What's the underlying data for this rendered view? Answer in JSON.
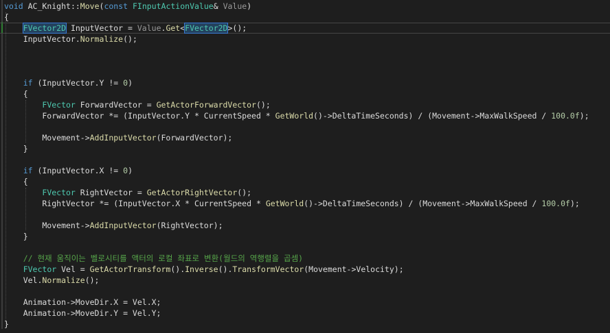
{
  "editor": {
    "colors": {
      "background": "#1e1e1e",
      "keyword": "#569cd6",
      "type": "#4ec9b0",
      "function": "#dcdcaa",
      "parameter": "#9a9a9a",
      "number": "#b5cea8",
      "comment": "#57a64a",
      "text": "#dcdcdc"
    },
    "lines": [
      [
        {
          "t": "void",
          "c": "kw"
        },
        {
          "t": " AC_Knight::"
        },
        {
          "t": "Move",
          "c": "fn"
        },
        {
          "t": "("
        },
        {
          "t": "const",
          "c": "kw"
        },
        {
          "t": " "
        },
        {
          "t": "FInputActionValue",
          "c": "ty"
        },
        {
          "t": "& "
        },
        {
          "t": "Value",
          "c": "pa"
        },
        {
          "t": ")"
        }
      ],
      [
        {
          "t": "{"
        }
      ],
      [
        {
          "t": "    "
        },
        {
          "t": "FVector2D",
          "c": "ty hl"
        },
        {
          "t": " InputVector = "
        },
        {
          "t": "Value",
          "c": "pa"
        },
        {
          "t": "."
        },
        {
          "t": "Get",
          "c": "fn"
        },
        {
          "t": "<"
        },
        {
          "t": "FVector2D",
          "c": "ty hl"
        },
        {
          "t": ">();"
        }
      ],
      [
        {
          "t": "    InputVector."
        },
        {
          "t": "Normalize",
          "c": "fn"
        },
        {
          "t": "();"
        }
      ],
      [],
      [],
      [],
      [
        {
          "t": "    "
        },
        {
          "t": "if",
          "c": "kw"
        },
        {
          "t": " (InputVector.Y != "
        },
        {
          "t": "0",
          "c": "nu"
        },
        {
          "t": ")"
        }
      ],
      [
        {
          "t": "    {"
        }
      ],
      [
        {
          "t": "        "
        },
        {
          "t": "FVector",
          "c": "ty"
        },
        {
          "t": " ForwardVector = "
        },
        {
          "t": "GetActorForwardVector",
          "c": "fn"
        },
        {
          "t": "();"
        }
      ],
      [
        {
          "t": "        ForwardVector *= (InputVector.Y * CurrentSpeed * "
        },
        {
          "t": "GetWorld",
          "c": "fn"
        },
        {
          "t": "()->DeltaTimeSeconds) / (Movement->MaxWalkSpeed / "
        },
        {
          "t": "100.0f",
          "c": "nu"
        },
        {
          "t": ");"
        }
      ],
      [],
      [
        {
          "t": "        Movement->"
        },
        {
          "t": "AddInputVector",
          "c": "fn"
        },
        {
          "t": "(ForwardVector);"
        }
      ],
      [
        {
          "t": "    }"
        }
      ],
      [],
      [
        {
          "t": "    "
        },
        {
          "t": "if",
          "c": "kw"
        },
        {
          "t": " (InputVector.X != "
        },
        {
          "t": "0",
          "c": "nu"
        },
        {
          "t": ")"
        }
      ],
      [
        {
          "t": "    {"
        }
      ],
      [
        {
          "t": "        "
        },
        {
          "t": "FVector",
          "c": "ty"
        },
        {
          "t": " RightVector = "
        },
        {
          "t": "GetActorRightVector",
          "c": "fn"
        },
        {
          "t": "();"
        }
      ],
      [
        {
          "t": "        RightVector *= (InputVector.X * CurrentSpeed * "
        },
        {
          "t": "GetWorld",
          "c": "fn"
        },
        {
          "t": "()->DeltaTimeSeconds) / (Movement->MaxWalkSpeed / "
        },
        {
          "t": "100.0f",
          "c": "nu"
        },
        {
          "t": ");"
        }
      ],
      [],
      [
        {
          "t": "        Movement->"
        },
        {
          "t": "AddInputVector",
          "c": "fn"
        },
        {
          "t": "(RightVector);"
        }
      ],
      [
        {
          "t": "    }"
        }
      ],
      [],
      [
        {
          "t": "    // 현재 움직이는 벨로시티를 액터의 로컬 좌표로 변환(월드의 역행렬을 곱셈)",
          "c": "cm"
        }
      ],
      [
        {
          "t": "    "
        },
        {
          "t": "FVector",
          "c": "ty"
        },
        {
          "t": " Vel = "
        },
        {
          "t": "GetActorTransform",
          "c": "fn"
        },
        {
          "t": "()."
        },
        {
          "t": "Inverse",
          "c": "fn"
        },
        {
          "t": "()."
        },
        {
          "t": "TransformVector",
          "c": "fn"
        },
        {
          "t": "(Movement->Velocity);"
        }
      ],
      [
        {
          "t": "    Vel."
        },
        {
          "t": "Normalize",
          "c": "fn"
        },
        {
          "t": "();"
        }
      ],
      [],
      [
        {
          "t": "    Animation->MoveDir.X = Vel.X;"
        }
      ],
      [
        {
          "t": "    Animation->MoveDir.Y = Vel.Y;"
        }
      ],
      [
        {
          "t": "}"
        }
      ]
    ],
    "current_line": 3
  }
}
